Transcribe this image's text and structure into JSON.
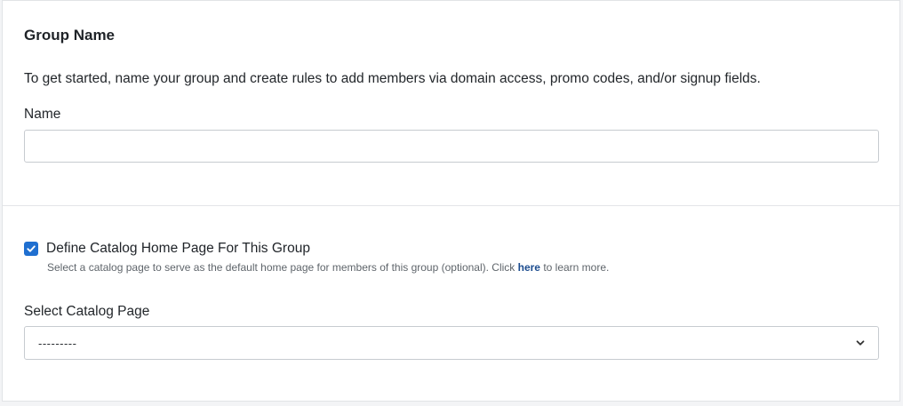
{
  "group_section": {
    "title": "Group Name",
    "intro": "To get started, name your group and create rules to add members via domain access, promo codes, and/or signup fields.",
    "name_label": "Name",
    "name_value": "",
    "name_placeholder": ""
  },
  "catalog_section": {
    "checkbox_checked": true,
    "checkbox_label": "Define Catalog Home Page For This Group",
    "help_prefix": "Select a catalog page to serve as the default home page for members of this group (optional). Click ",
    "help_link": "here",
    "help_suffix": " to learn more.",
    "select_label": "Select Catalog Page",
    "select_value": "---------"
  },
  "colors": {
    "accent": "#1f6fd0",
    "link": "#1c4c8f"
  },
  "icons": {
    "checkbox": "checkmark-icon",
    "select": "chevron-down-icon"
  }
}
